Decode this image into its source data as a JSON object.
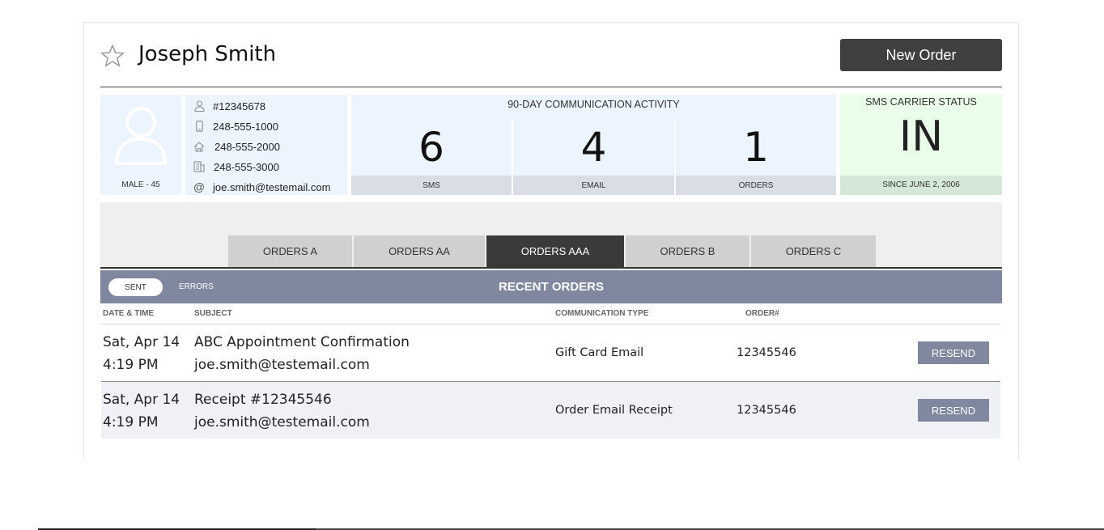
{
  "customer": {
    "name": "Joseph Smith",
    "gender_age": "MALE - 45"
  },
  "header": {
    "new_order_label": "New Order"
  },
  "contact": {
    "id": "#12345678",
    "mobile": "248-555-1000",
    "home": "248-555-2000",
    "work": "248-555-3000",
    "email": "joe.smith@testemail.com"
  },
  "activity": {
    "title": "90-DAY COMMUNICATION ACTIVITY",
    "metrics": [
      {
        "value": "6",
        "label": "SMS"
      },
      {
        "value": "4",
        "label": "EMAIL"
      },
      {
        "value": "1",
        "label": "ORDERS"
      }
    ]
  },
  "carrier": {
    "title": "SMS CARRIER STATUS",
    "value": "IN",
    "since": "SINCE JUNE 2, 2006"
  },
  "tabs": [
    {
      "label": "ORDERS A",
      "active": false
    },
    {
      "label": "ORDERS AA",
      "active": false
    },
    {
      "label": "ORDERS AAA",
      "active": true
    },
    {
      "label": "ORDERS B",
      "active": false
    },
    {
      "label": "ORDERS C",
      "active": false
    }
  ],
  "recent_orders": {
    "title": "RECENT ORDERS",
    "filters": {
      "sent": "SENT",
      "errors": "ERRORS"
    },
    "columns": {
      "datetime": "DATE & TIME",
      "subject": "SUBJECT",
      "type": "COMMUNICATION TYPE",
      "order": "ORDER#"
    },
    "rows": [
      {
        "date": "Sat, Apr 14",
        "time": "4:19 PM",
        "subject": "ABC Appointment Confirmation",
        "recipient": "joe.smith@testemail.com",
        "type": "Gift Card Email",
        "order": "12345546",
        "action": "RESEND"
      },
      {
        "date": "Sat, Apr 14",
        "time": "4:19 PM",
        "subject": "Receipt #12345546",
        "recipient": "joe.smith@testemail.com",
        "type": "Order Email Receipt",
        "order": "12345546",
        "action": "RESEND"
      }
    ]
  },
  "colors": {
    "primary_dark": "#404040",
    "panel_blue": "#ecf4fe",
    "panel_green": "#eaffea",
    "bar_slate": "#7f889e"
  }
}
